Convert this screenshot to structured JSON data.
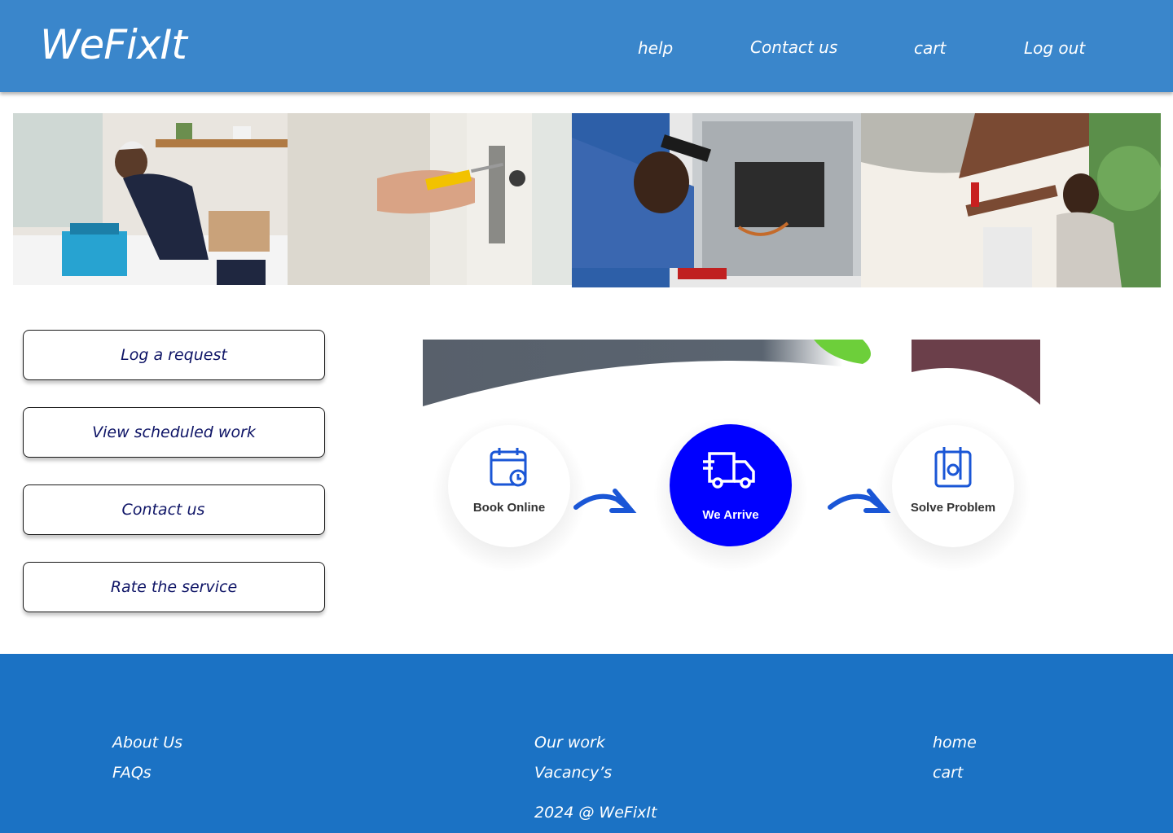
{
  "header": {
    "logo": "WeFixIt",
    "nav": {
      "help": "help",
      "contact": "Contact us",
      "cart": "cart",
      "logout": "Log out"
    }
  },
  "actions": {
    "log_request": "Log a request",
    "view_scheduled": "View scheduled work",
    "contact": "Contact us",
    "rate": "Rate the service"
  },
  "process": {
    "steps": [
      "Book Online",
      "We Arrive",
      "Solve Problem"
    ],
    "step_icons": [
      "calendar-clock-icon",
      "delivery-truck-icon",
      "repair-tools-icon"
    ],
    "active_color": "#0000ff",
    "arrow_color": "#1a56d6"
  },
  "footer": {
    "col1": [
      "About Us",
      "FAQs"
    ],
    "col2": [
      "Our work",
      "Vacancy’s"
    ],
    "col3": [
      "home",
      "cart"
    ],
    "copyright": "2024 @ WeFixIt"
  },
  "colors": {
    "header_bg": "#3a86cb",
    "footer_bg": "#1b72c4",
    "button_text": "#0e1466"
  }
}
